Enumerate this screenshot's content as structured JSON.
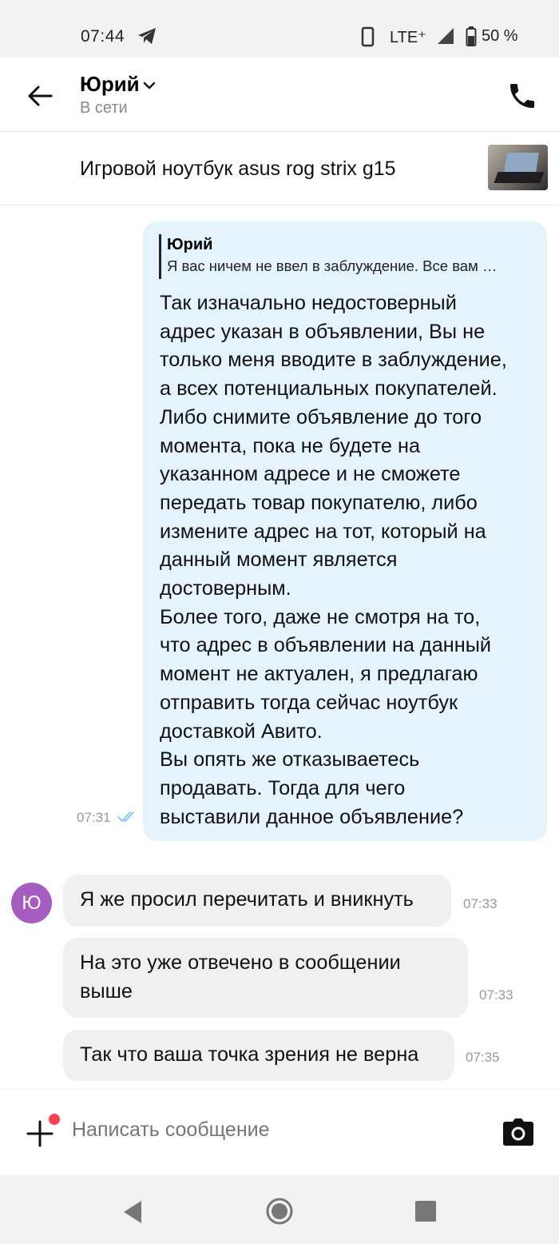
{
  "status_bar": {
    "time": "07:44",
    "network": "LTE⁺",
    "battery": "50 %"
  },
  "header": {
    "contact_name": "Юрий",
    "status": "В сети"
  },
  "item": {
    "title": "Игровой ноутбук asus rog strix g15"
  },
  "messages": [
    {
      "direction": "outgoing",
      "quote_author": "Юрий",
      "quote_text": "Я вас ничем не ввел в заблуждение. Все вам …",
      "text": "Так изначально недостоверный\nадрес указан в объявлении, Вы не\nтолько меня вводите в заблуждение,\nа всех потенциальных покупателей.\nЛибо снимите объявление до того\nмомента, пока не будете на\nуказанном адресе и не сможете\nпередать товар покупателю, либо\nизмените адрес на тот, который на\nданный момент является\nдостоверным.\nБолее того, даже не смотря на то,\nчто адрес в объявлении на данный\nмомент не актуален, я предлагаю\nотправить тогда сейчас ноутбук\nдоставкой Авито.\nВы опять же отказываетесь\nпродавать. Тогда для чего\nвыставили данное объявление?",
      "time": "07:31",
      "read": true
    },
    {
      "direction": "incoming",
      "text": "Я же просил перечитать и вникнуть",
      "time": "07:33"
    },
    {
      "direction": "incoming",
      "text": "На это уже отвечено в сообщении\nвыше",
      "time": "07:33"
    },
    {
      "direction": "incoming",
      "text": "Так что ваша точка зрения не верна",
      "time": "07:35"
    }
  ],
  "avatar_letter": "Ю",
  "composer": {
    "placeholder": "Написать сообщение"
  },
  "icons": {
    "back": "arrow-left-icon",
    "call": "phone-icon",
    "attach": "plus-icon",
    "camera": "camera-icon",
    "read": "double-check-icon"
  },
  "colors": {
    "outgoing_bubble": "#e5f3fd",
    "incoming_bubble": "#f0f0f0",
    "avatar": "#a55dbf",
    "notification_dot": "#ff4053",
    "read_ticks": "#80c4f5"
  }
}
